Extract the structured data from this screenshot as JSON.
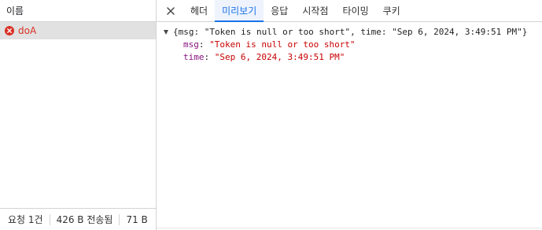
{
  "left": {
    "header": "이름",
    "requests": [
      {
        "name": "doA",
        "status": "error"
      }
    ],
    "status_bar": {
      "requests": "요청 1건",
      "transferred": "426 B 전송됨",
      "resources": "71 B"
    }
  },
  "tabs": [
    {
      "label": "헤더",
      "active": false
    },
    {
      "label": "미리보기",
      "active": true
    },
    {
      "label": "응답",
      "active": false
    },
    {
      "label": "시작점",
      "active": false
    },
    {
      "label": "타이밍",
      "active": false
    },
    {
      "label": "쿠키",
      "active": false
    }
  ],
  "preview": {
    "summary": "{msg: \"Token is null or too short\", time: \"Sep 6, 2024, 3:49:51 PM\"}",
    "fields": [
      {
        "key": "msg",
        "value": "\"Token is null or too short\""
      },
      {
        "key": "time",
        "value": "\"Sep 6, 2024, 3:49:51 PM\""
      }
    ]
  },
  "colors": {
    "accent": "#1a73e8",
    "error": "#d93025",
    "json_key": "#881280",
    "json_string": "#c80000"
  },
  "icons": {
    "close": "close-icon",
    "error": "error-icon",
    "expand": "expand-triangle-icon"
  }
}
